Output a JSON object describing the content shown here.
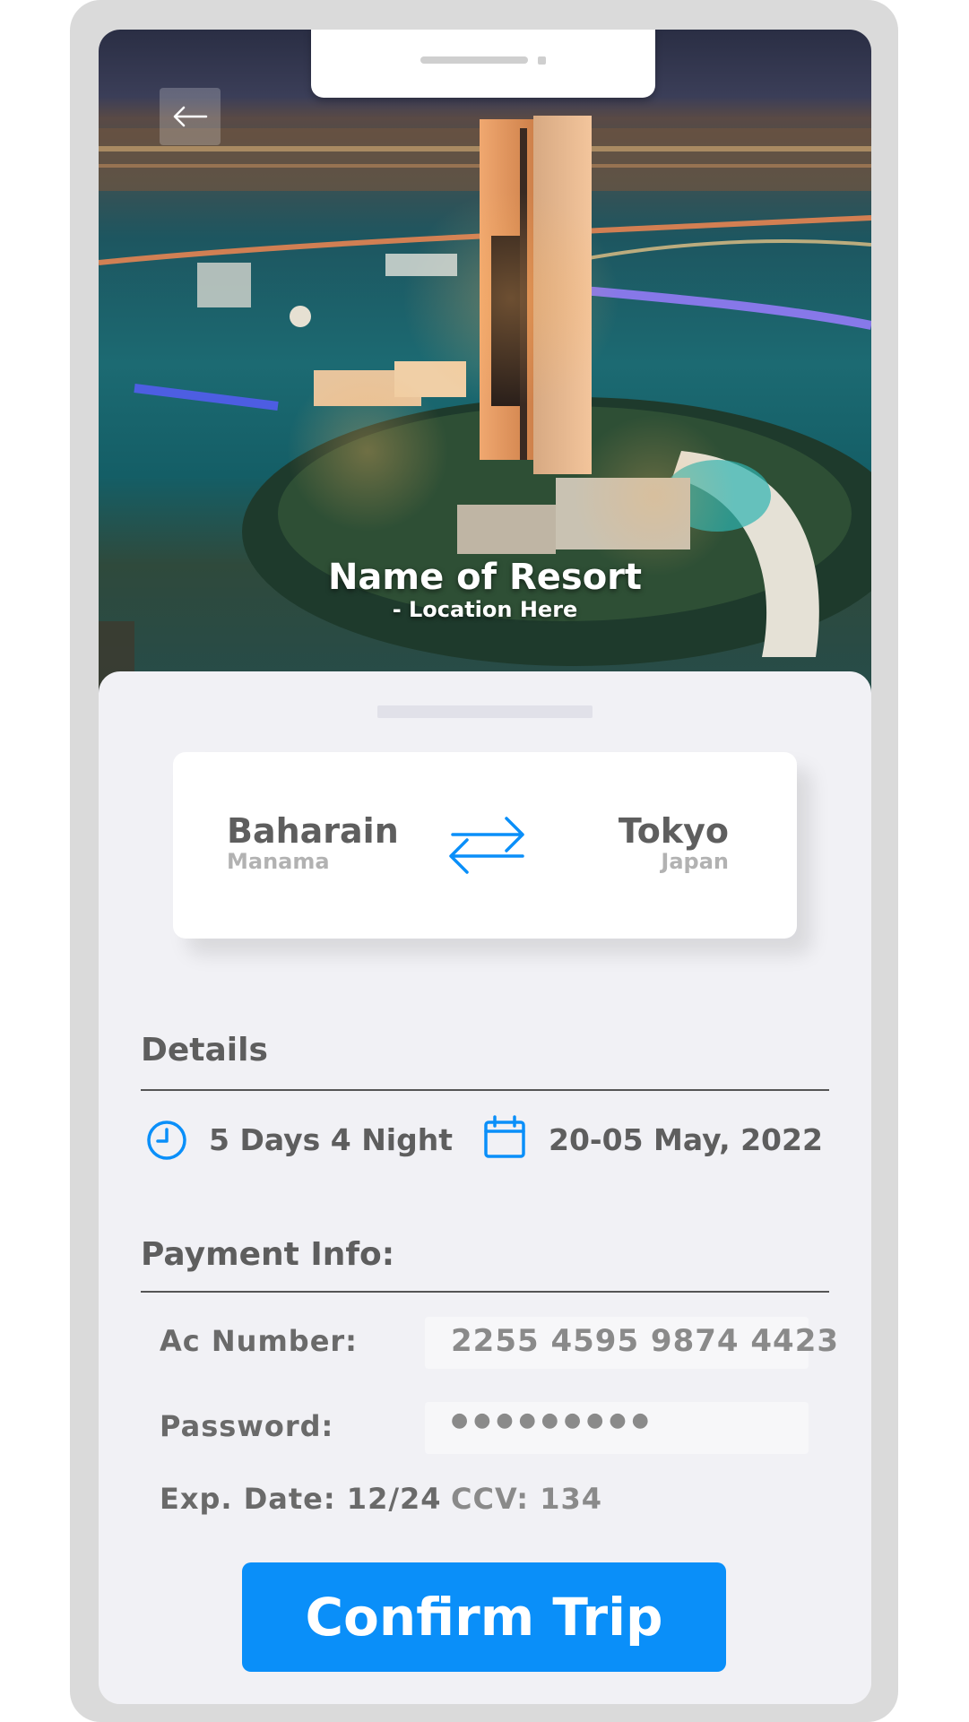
{
  "resort": {
    "name": "Name of Resort",
    "location": "- Location Here"
  },
  "route": {
    "from_city": "Baharain",
    "from_sub": "Manama",
    "to_city": "Tokyo",
    "to_sub": "Japan"
  },
  "details": {
    "title": "Details",
    "duration": "5 Days 4 Night",
    "dates": "20-05 May, 2022"
  },
  "payment": {
    "title": "Payment Info:",
    "ac_label": "Ac Number:",
    "ac_value": "2255 4595 9874 4423",
    "password_label": "Password:",
    "password_value": "●●●●●●●●●",
    "exp_label": "Exp. Date: 12/24",
    "ccv_label": "CCV: 134"
  },
  "actions": {
    "confirm_label": "Confirm Trip"
  },
  "colors": {
    "accent": "#0a8ff9",
    "text": "#5e5e5e",
    "muted": "#b2b2b2",
    "background": "#f1f1f5"
  },
  "icons": {
    "back": "arrow-left-icon",
    "swap": "swap-arrows-icon",
    "duration": "clock-icon",
    "dates": "calendar-icon"
  }
}
